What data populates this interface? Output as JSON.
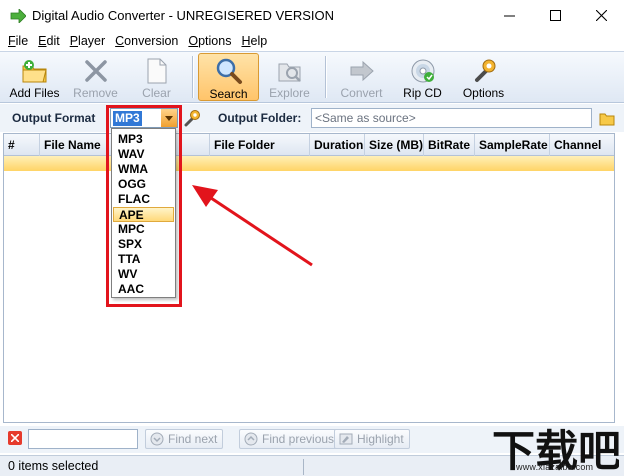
{
  "window": {
    "title": "Digital Audio Converter - UNREGISERED VERSION"
  },
  "menu": [
    {
      "label": "File",
      "key": "F",
      "rest": "ile"
    },
    {
      "label": "Edit",
      "key": "E",
      "rest": "dit"
    },
    {
      "label": "Player",
      "key": "P",
      "rest": "layer"
    },
    {
      "label": "Conversion",
      "key": "C",
      "rest": "onversion"
    },
    {
      "label": "Options",
      "key": "O",
      "rest": "ptions"
    },
    {
      "label": "Help",
      "key": "H",
      "rest": "elp"
    }
  ],
  "toolbar": {
    "add_files": "Add Files",
    "remove": "Remove",
    "clear": "Clear",
    "search": "Search",
    "explore": "Explore",
    "convert": "Convert",
    "rip_cd": "Rip CD",
    "options": "Options"
  },
  "output": {
    "format_label": "Output Format",
    "format_value": "MP3",
    "folder_label": "Output Folder:",
    "folder_placeholder": "<Same as source>"
  },
  "grid": {
    "columns": [
      "#",
      "File Name",
      "File Folder",
      "Duration",
      "Size (MB)",
      "BitRate",
      "SampleRate",
      "Channel"
    ]
  },
  "format_dropdown": {
    "options": [
      "MP3",
      "WAV",
      "WMA",
      "OGG",
      "FLAC",
      "APE",
      "MPC",
      "SPX",
      "TTA",
      "WV",
      "AAC"
    ],
    "highlighted": "APE"
  },
  "findbar": {
    "find_next": "Find next",
    "find_previous": "Find previous",
    "highlight": "Highlight"
  },
  "status": {
    "text": "0 items selected"
  },
  "watermark": {
    "text": "下载吧",
    "url": "www.xiazaiba.com"
  },
  "colors": {
    "accent": "#3178d6",
    "annotation_red": "#e2141c",
    "selection_gold": "#ffd466"
  }
}
